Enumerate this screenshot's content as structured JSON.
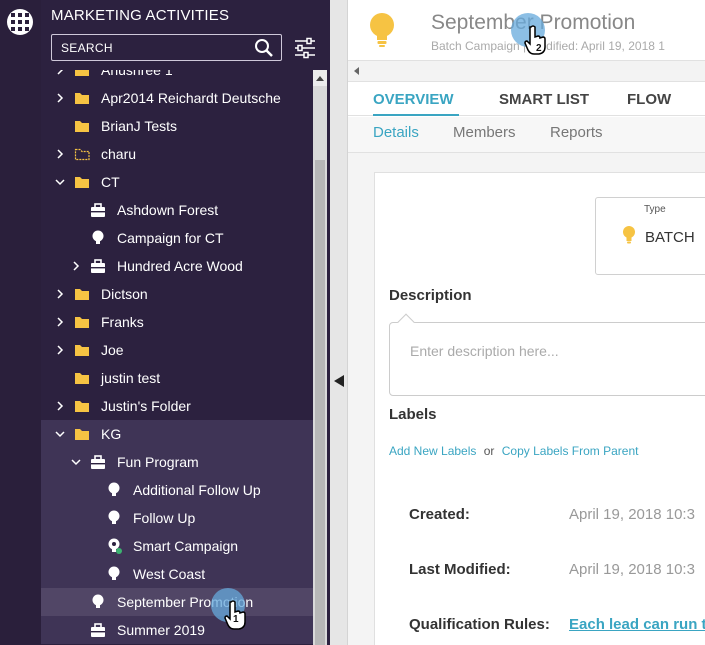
{
  "sidebar": {
    "title": "MARKETING ACTIVITIES",
    "search_placeholder": "SEARCH",
    "tree": [
      {
        "label": "Anushree 1",
        "type": "folder",
        "indent": 0,
        "chevron": "right"
      },
      {
        "label": "Apr2014 Reichardt Deutsche",
        "type": "folder",
        "indent": 0,
        "chevron": "right"
      },
      {
        "label": "BrianJ Tests",
        "type": "folder",
        "indent": 0,
        "chevron": "none"
      },
      {
        "label": "charu",
        "type": "folder-outline",
        "indent": 0,
        "chevron": "right"
      },
      {
        "label": "CT",
        "type": "folder",
        "indent": 0,
        "chevron": "down"
      },
      {
        "label": "Ashdown Forest",
        "type": "program",
        "indent": 1,
        "chevron": "none"
      },
      {
        "label": "Campaign for CT",
        "type": "campaign",
        "indent": 1,
        "chevron": "none"
      },
      {
        "label": "Hundred Acre Wood",
        "type": "program",
        "indent": 1,
        "chevron": "right"
      },
      {
        "label": "Dictson",
        "type": "folder",
        "indent": 0,
        "chevron": "right"
      },
      {
        "label": "Franks",
        "type": "folder",
        "indent": 0,
        "chevron": "right"
      },
      {
        "label": "Joe",
        "type": "folder",
        "indent": 0,
        "chevron": "right"
      },
      {
        "label": "justin test",
        "type": "folder",
        "indent": 0,
        "chevron": "none"
      },
      {
        "label": "Justin's Folder",
        "type": "folder",
        "indent": 0,
        "chevron": "right"
      },
      {
        "label": "KG",
        "type": "folder",
        "indent": 0,
        "chevron": "down",
        "group": true
      },
      {
        "label": "Fun Program",
        "type": "program",
        "indent": 1,
        "chevron": "down",
        "group": true
      },
      {
        "label": "Additional Follow Up",
        "type": "campaign",
        "indent": 2,
        "chevron": "none",
        "group": true
      },
      {
        "label": "Follow Up",
        "type": "campaign",
        "indent": 2,
        "chevron": "none",
        "group": true
      },
      {
        "label": "Smart Campaign",
        "type": "campaign-active",
        "indent": 2,
        "chevron": "none",
        "group": true
      },
      {
        "label": "West Coast",
        "type": "campaign",
        "indent": 2,
        "chevron": "none",
        "group": true
      },
      {
        "label": "September Promotion",
        "type": "campaign",
        "indent": 1,
        "chevron": "none",
        "group": true,
        "selected": true
      },
      {
        "label": "Summer 2019",
        "type": "program",
        "indent": 1,
        "chevron": "none",
        "group": true
      }
    ]
  },
  "header": {
    "title": "September Promotion",
    "subtitle": "Batch Campaign | Modified: April 19, 2018 1"
  },
  "tabs": [
    {
      "label": "OVERVIEW",
      "active": true
    },
    {
      "label": "SMART LIST",
      "active": false
    },
    {
      "label": "FLOW",
      "active": false
    }
  ],
  "subtabs": [
    {
      "label": "Details",
      "active": true
    },
    {
      "label": "Members",
      "active": false
    },
    {
      "label": "Reports",
      "active": false
    }
  ],
  "details": {
    "type_label": "Type",
    "type_value": "BATCH",
    "description_label": "Description",
    "description_placeholder": "Enter description here...",
    "labels_label": "Labels",
    "add_labels": "Add New Labels",
    "or_text": "or",
    "copy_labels": "Copy Labels From Parent",
    "created_label": "Created:",
    "created_value": "April 19, 2018 10:3",
    "modified_label": "Last Modified:",
    "modified_value": "April 19, 2018 10:3",
    "qualification_label": "Qualification Rules:",
    "qualification_value": "Each lead can run th"
  },
  "cursors": [
    {
      "number": "1"
    },
    {
      "number": "2"
    }
  ],
  "colors": {
    "sidebar_bg": "#2c213f",
    "accent": "#3aa5c2",
    "folder": "#f6c343",
    "bulb": "#f6c343"
  }
}
